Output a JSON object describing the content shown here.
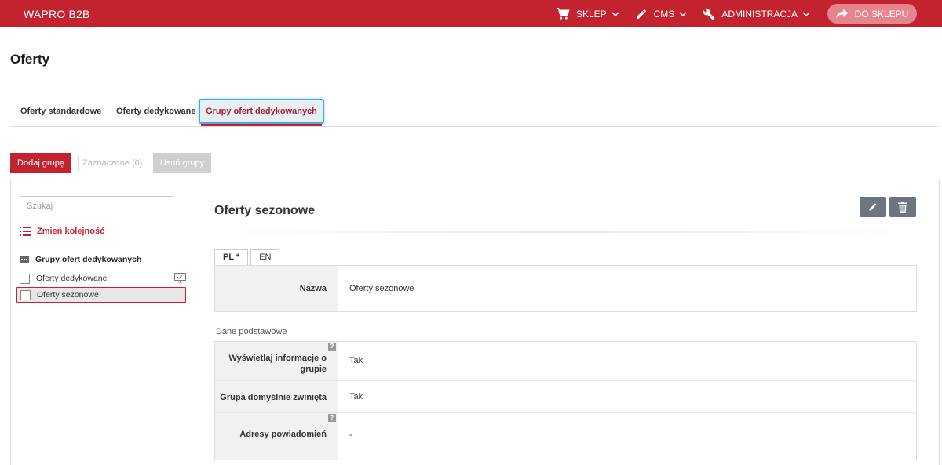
{
  "app": {
    "brand": "WAPRO B2B"
  },
  "topnav": {
    "shop": "SKLEP",
    "cms": "CMS",
    "admin": "ADMINISTRACJA",
    "to_store": "DO SKLEPU"
  },
  "page": {
    "title": "Oferty"
  },
  "tabs": [
    {
      "label": "Oferty standardowe"
    },
    {
      "label": "Oferty dedykowane"
    },
    {
      "label": "Grupy ofert dedykowanych",
      "active": true
    }
  ],
  "actions": {
    "add_group": "Dodaj grupę",
    "selected": "Zaznaczone (0)",
    "remove_groups": "Usuń grupy"
  },
  "sidebar": {
    "search_placeholder": "Szukaj",
    "reorder": "Zmień kolejność",
    "tree_header": "Grupy ofert dedykowanych",
    "items": [
      {
        "label": "Oferty dedykowane"
      },
      {
        "label": "Oferty sezonowe",
        "selected": true
      }
    ]
  },
  "detail": {
    "title": "Oferty sezonowe",
    "lang_tabs": [
      "PL *",
      "EN"
    ],
    "name_label": "Nazwa",
    "name_value": "Oferty sezonowe",
    "section_basic": "Dane podstawowe",
    "fields": [
      {
        "label": "Wyświetlaj informacje o grupie",
        "value": "Tak",
        "help": "?"
      },
      {
        "label": "Grupa domyślnie zwinięta",
        "value": "Tak"
      },
      {
        "label": "Adresy powiadomień",
        "value": "-",
        "help": "?"
      }
    ]
  },
  "colors": {
    "accent": "#c3232f",
    "tab_focus": "#3fa9e0",
    "icon_button": "#6d7680"
  },
  "icons": [
    "cart-icon",
    "pencil-icon",
    "wrench-icon",
    "share-arrow-icon",
    "list-icon",
    "folder-icon",
    "monitor-check-icon",
    "edit-icon",
    "trash-icon"
  ]
}
